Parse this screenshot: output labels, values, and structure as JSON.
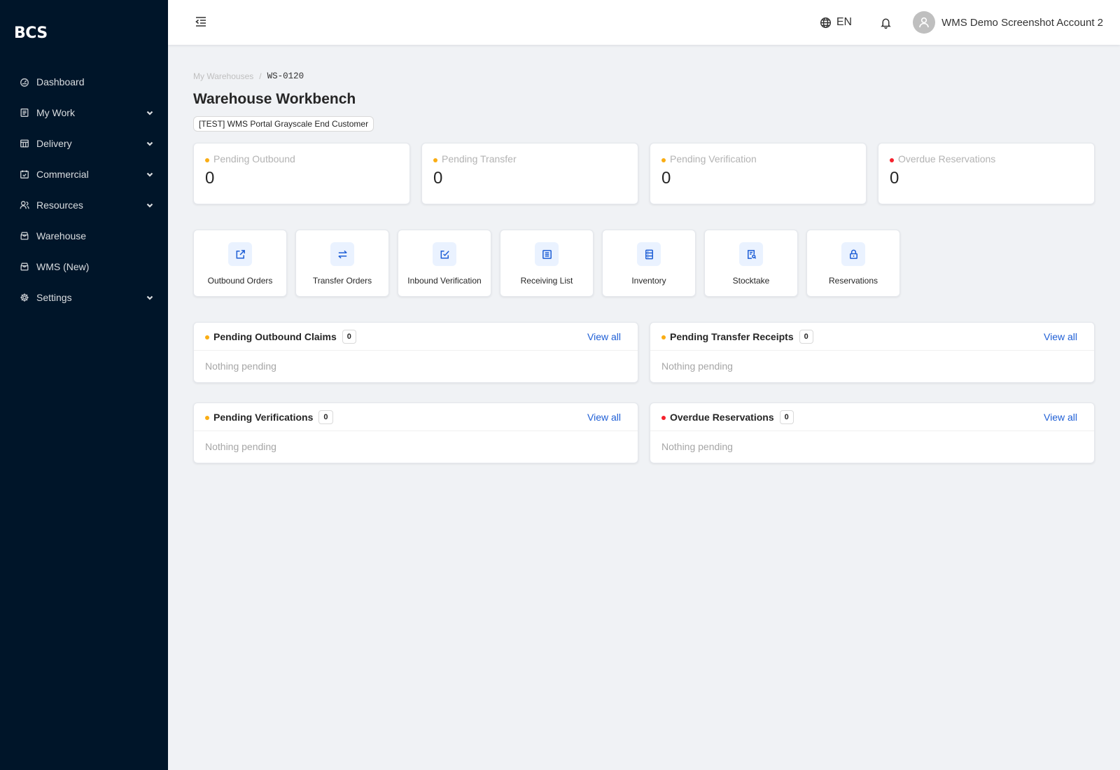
{
  "app": {
    "logo": "BCS"
  },
  "sidebar": {
    "items": [
      {
        "label": "Dashboard",
        "icon": "dashboard-icon",
        "expandable": false
      },
      {
        "label": "My Work",
        "icon": "list-icon",
        "expandable": true
      },
      {
        "label": "Delivery",
        "icon": "store-icon",
        "expandable": true
      },
      {
        "label": "Commercial",
        "icon": "calendar-icon",
        "expandable": true
      },
      {
        "label": "Resources",
        "icon": "users-icon",
        "expandable": true
      },
      {
        "label": "Warehouse",
        "icon": "shop-icon",
        "expandable": false
      },
      {
        "label": "WMS (New)",
        "icon": "shop-icon",
        "expandable": false
      },
      {
        "label": "Settings",
        "icon": "gear-icon",
        "expandable": true
      }
    ]
  },
  "header": {
    "language": "EN",
    "account_name": "WMS Demo Screenshot Account 2"
  },
  "breadcrumb": {
    "parent": "My Warehouses",
    "separator": "/",
    "current": "WS-0120"
  },
  "page": {
    "title": "Warehouse Workbench",
    "customer_tag": "[TEST] WMS Portal Grayscale End Customer"
  },
  "stats": [
    {
      "label": "Pending Outbound",
      "value": "0",
      "color": "#faad14"
    },
    {
      "label": "Pending Transfer",
      "value": "0",
      "color": "#faad14"
    },
    {
      "label": "Pending Verification",
      "value": "0",
      "color": "#faad14"
    },
    {
      "label": "Overdue Reservations",
      "value": "0",
      "color": "#f5222d"
    }
  ],
  "quick_actions": [
    {
      "label": "Outbound Orders",
      "icon": "export-icon"
    },
    {
      "label": "Transfer Orders",
      "icon": "swap-icon"
    },
    {
      "label": "Inbound Verification",
      "icon": "edit-check-icon"
    },
    {
      "label": "Receiving List",
      "icon": "list-doc-icon"
    },
    {
      "label": "Inventory",
      "icon": "database-icon"
    },
    {
      "label": "Stocktake",
      "icon": "audit-icon"
    },
    {
      "label": "Reservations",
      "icon": "lock-icon"
    }
  ],
  "panels": [
    {
      "title": "Pending Outbound Claims",
      "count": "0",
      "link": "View all",
      "empty": "Nothing pending",
      "color": "#faad14"
    },
    {
      "title": "Pending Transfer Receipts",
      "count": "0",
      "link": "View all",
      "empty": "Nothing pending",
      "color": "#faad14"
    },
    {
      "title": "Pending Verifications",
      "count": "0",
      "link": "View all",
      "empty": "Nothing pending",
      "color": "#faad14"
    },
    {
      "title": "Overdue Reservations",
      "count": "0",
      "link": "View all",
      "empty": "Nothing pending",
      "color": "#f5222d"
    }
  ],
  "colors": {
    "sidebar_bg": "#001529",
    "accent": "#1f5fd6",
    "warning": "#faad14",
    "danger": "#f5222d"
  }
}
